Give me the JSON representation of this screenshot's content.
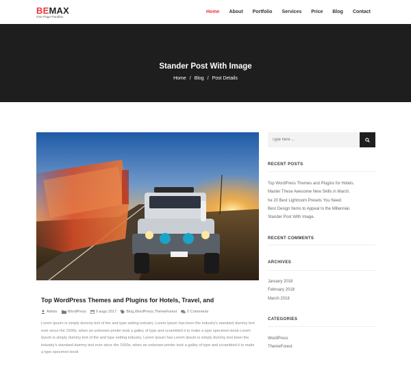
{
  "brand": {
    "name_part1": "BE",
    "name_part2": "MAX",
    "tagline": "One Page Parallax"
  },
  "nav": {
    "items": [
      {
        "label": "Home",
        "active": true
      },
      {
        "label": "About"
      },
      {
        "label": "Portfolio"
      },
      {
        "label": "Services"
      },
      {
        "label": "Price"
      },
      {
        "label": "Blog"
      },
      {
        "label": "Contact"
      }
    ],
    "accent_color": "#e8383d"
  },
  "hero": {
    "title": "Stander Post With Image",
    "breadcrumb": [
      "Home",
      "Blog",
      "Post Details"
    ],
    "separator": "/"
  },
  "post": {
    "title": "Top WordPress Themes and Plugins for Hotels, Travel, and",
    "meta": {
      "author": "Admin",
      "category": "WordPress",
      "date": "9 augu 2017",
      "tags": "Blog,WordPress,ThemeForest",
      "comments": "0 Comments"
    },
    "body": "Lorem Ipsum is simply dummy text of the and type setting industry. Lorem Ipsum has been the industry's standard dummy text ever since the 1500s, when an unknown printer took a galley of type and scrambled it to make a type specimen book Lorem Ipsum is simply dummy text of the and type setting industry. Lorem Ipsum has Lorem Ipsum is simply dummy text been the industry's standard dummy text ever since the 1500s, when an unknown printer took a galley of type and scrambled it to make a type specimen book"
  },
  "sidebar": {
    "search": {
      "placeholder": "Type here ..."
    },
    "recent_posts": {
      "title": "RECENT POSTS",
      "items": [
        "Top WordPress Themes and Plugins for Hotels.",
        "Master These Awesome New Skills in March.",
        "he 20 Best Lightroom Presets You Need.",
        "Best Design Items to Appeal to the Millennial.",
        "Stander Post With Image."
      ]
    },
    "recent_comments": {
      "title": "RECENT COMMENTS"
    },
    "archives": {
      "title": "ARCHIVES",
      "items": [
        "January 2018",
        "February 2018",
        "March 2018"
      ]
    },
    "categories": {
      "title": "CATEGORIES",
      "items": [
        "WordPress",
        "ThemeForest"
      ]
    }
  }
}
